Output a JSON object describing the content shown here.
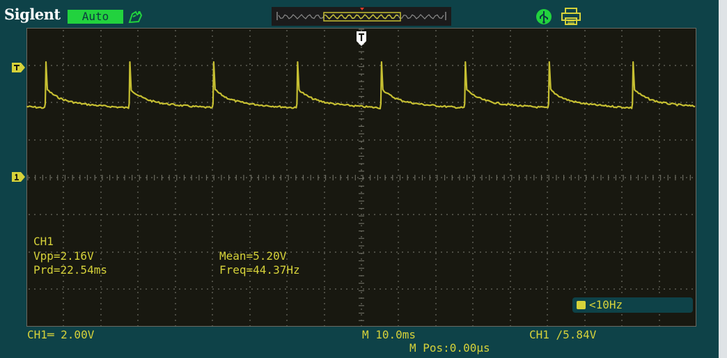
{
  "header": {
    "brand": "Siglent",
    "mode": "Auto"
  },
  "icons": {
    "run": "pointing-hand-icon",
    "memory_window": "timebase-window-icon",
    "usb": "usb-icon",
    "printer": "printer-icon"
  },
  "colors": {
    "trace": "#c6bf32",
    "text": "#d6d23a",
    "mode_badge": "#22d23e",
    "frame": "#0e4248",
    "screen": "#181810"
  },
  "measurements": {
    "channel": "CH1",
    "vpp": "Vpp=2.16V",
    "mean": "Mean=5.20V",
    "period": "Prd=22.54ms",
    "freq": "Freq=44.37Hz"
  },
  "trigger": {
    "filter_text": "<10Hz",
    "level_text": "CH1 /5.84V"
  },
  "status": {
    "ch1_scale": "CH1═ 2.00V",
    "timebase": "M 10.0ms",
    "position": "M Pos:0.00μs"
  },
  "waveform": {
    "period_ms": 22.54,
    "vpp_v": 2.16,
    "mean_v": 5.2,
    "volts_per_div": 2.0,
    "ms_per_div": 10.0,
    "trigger_level_v": 5.84
  }
}
